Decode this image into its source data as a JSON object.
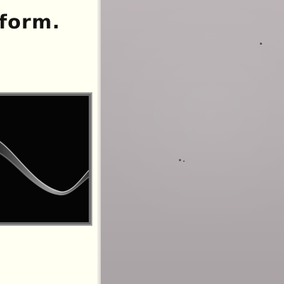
{
  "photo": {
    "caption_text": "form."
  },
  "screen": {
    "display_name": "waveform-display"
  },
  "colors": {
    "paper": "#fffff2",
    "wall": "#b7b0b2",
    "screen_bg": "#050505",
    "frame": "#6b6b6b"
  }
}
